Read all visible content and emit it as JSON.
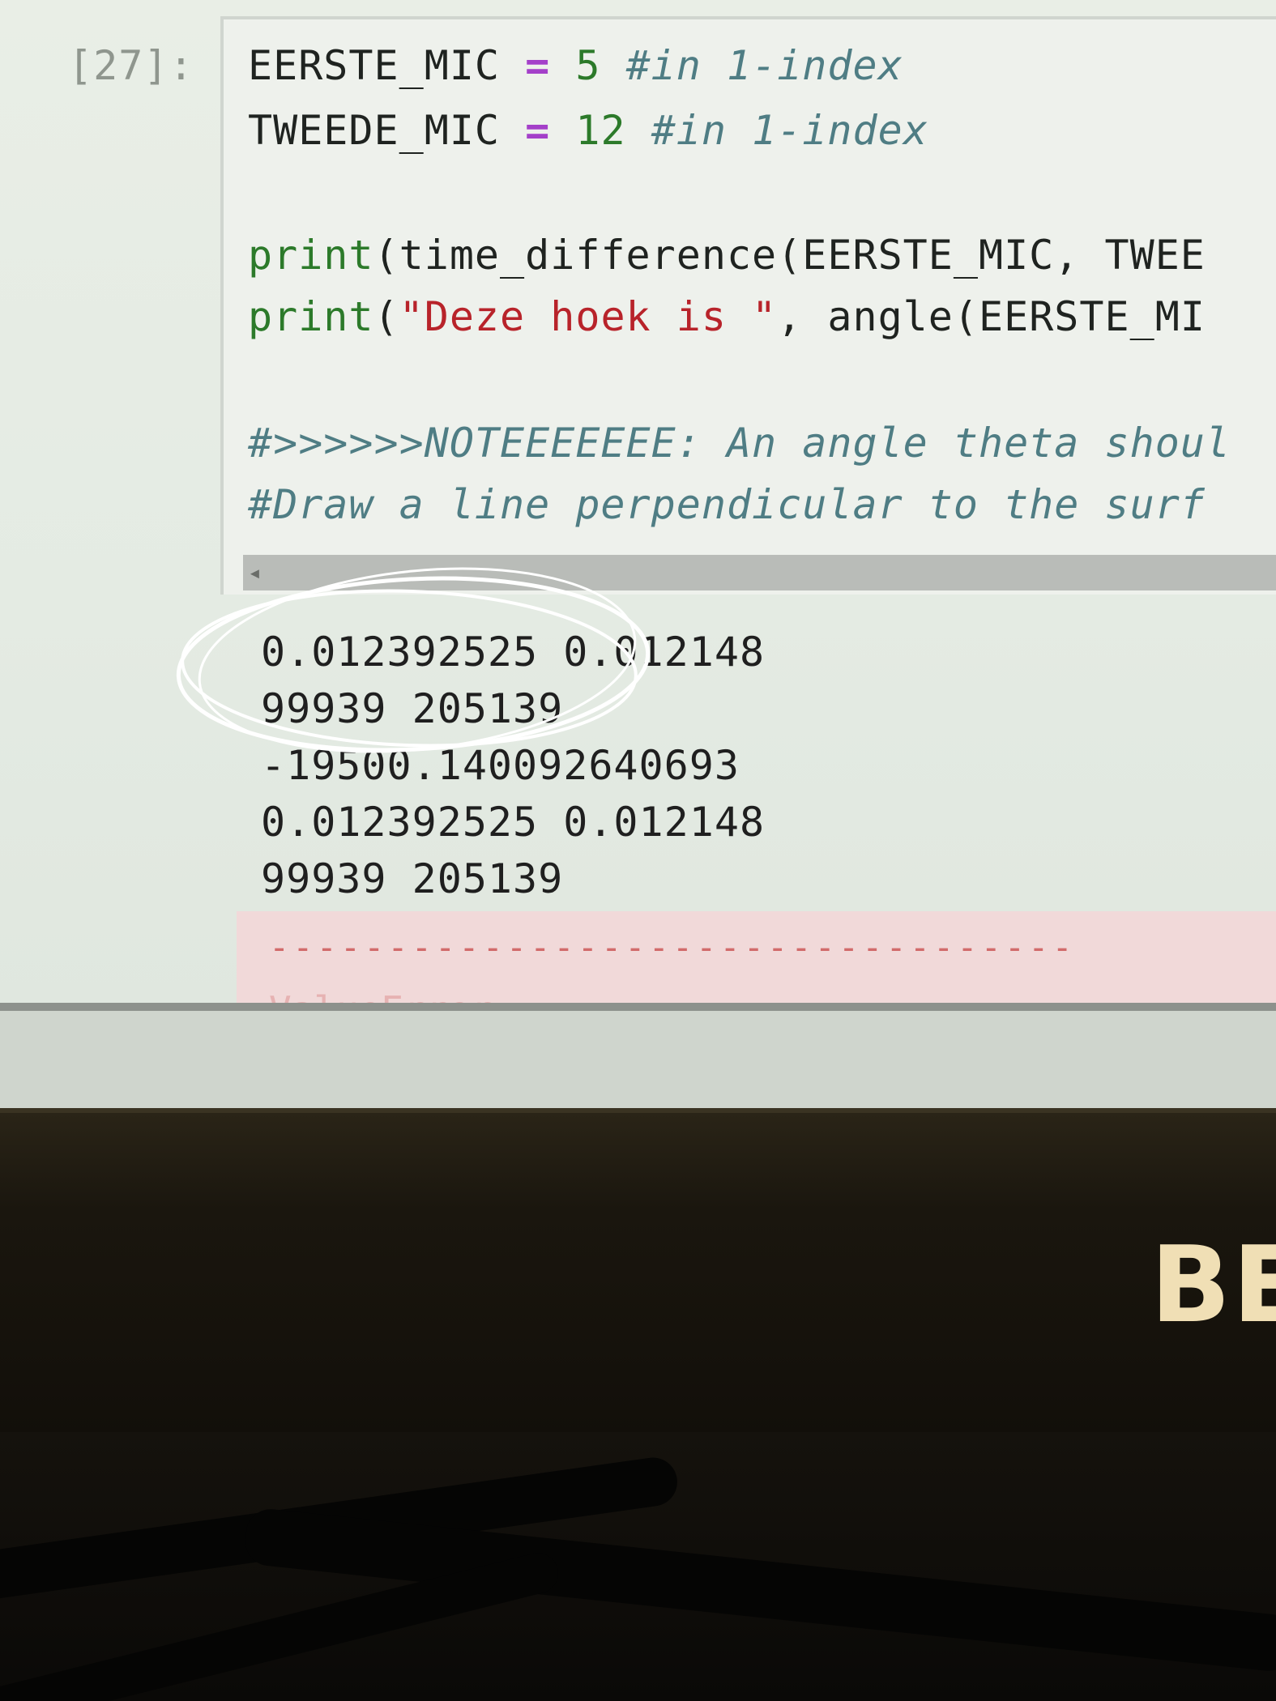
{
  "cell": {
    "prompt": "[27]:",
    "code": [
      {
        "name": "EERSTE_MIC",
        "op": "=",
        "value": "5",
        "comment": "#in 1-index"
      },
      {
        "name": "TWEEDE_MIC",
        "op": "=",
        "value": "12",
        "comment": "#in 1-index"
      }
    ],
    "print1": {
      "fn": "print",
      "rest": "(time_difference(EERSTE_MIC, TWEE"
    },
    "print2": {
      "fn": "print",
      "open": "(",
      "string": "\"Deze hoek is \"",
      "rest": ", angle(EERSTE_MI"
    },
    "comment1": "#>>>>>>NOTEEEEEEE: An angle theta shoul",
    "comment2": "#Draw a line perpendicular to the surf"
  },
  "output": {
    "lines": [
      "0.012392525 0.012148",
      "99939 205139",
      "-19500.140092640693",
      "0.012392525 0.012148",
      "99939 205139"
    ]
  },
  "error": {
    "dashes": "----------------------------------",
    "name": "ValueError"
  },
  "monitor": {
    "brand": "BE"
  },
  "colors": {
    "screen_bg": "#e9eee6",
    "keyword_green": "#2c7a2a",
    "operator_purple": "#a440c9",
    "string_red": "#b8232a",
    "comment_teal": "#4f7d84",
    "error_bg": "#f1d9d9"
  }
}
